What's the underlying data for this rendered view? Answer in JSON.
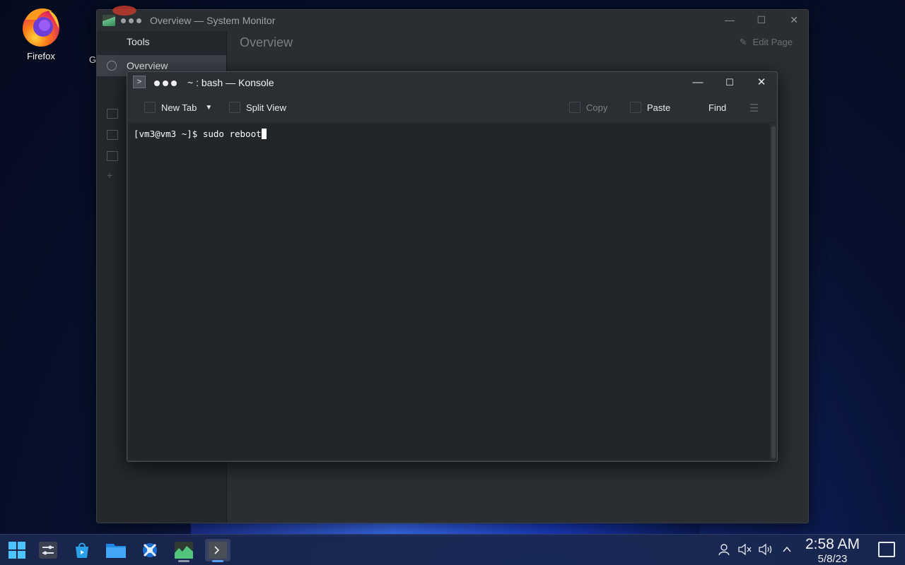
{
  "desktop": {
    "icons": [
      {
        "label": "Firefox",
        "icon": "firefox-icon"
      },
      {
        "label": "G",
        "icon": "partially-hidden-icon"
      }
    ]
  },
  "sysmon": {
    "title": "Overview — System Monitor",
    "sidebar_header": "Tools",
    "sidebar_selected": "Overview",
    "page_title": "Overview",
    "edit_page_label": "Edit Page"
  },
  "konsole": {
    "title": "~ : bash — Konsole",
    "toolbar": {
      "new_tab": "New Tab",
      "split_view": "Split View",
      "copy": "Copy",
      "paste": "Paste",
      "find": "Find"
    },
    "terminal": {
      "prompt": "[vm3@vm3 ~]$ ",
      "command": "sudo reboot"
    }
  },
  "taskbar": {
    "items": [
      "start-menu-icon",
      "system-settings-icon",
      "discover-store-icon",
      "dolphin-files-icon",
      "kde-connect-icon",
      "system-monitor-icon",
      "konsole-icon"
    ],
    "tray": [
      "user-status-icon",
      "mic-muted-icon",
      "volume-icon",
      "expand-tray-icon"
    ],
    "clock": {
      "time": "2:58 AM",
      "date": "5/8/23"
    }
  },
  "colors": {
    "accent": "#3daee9",
    "window_bg": "#2b2f33",
    "terminal_bg": "#232629",
    "firefox_orange": "#ff7a18",
    "firefox_purple": "#6e3fd8"
  }
}
